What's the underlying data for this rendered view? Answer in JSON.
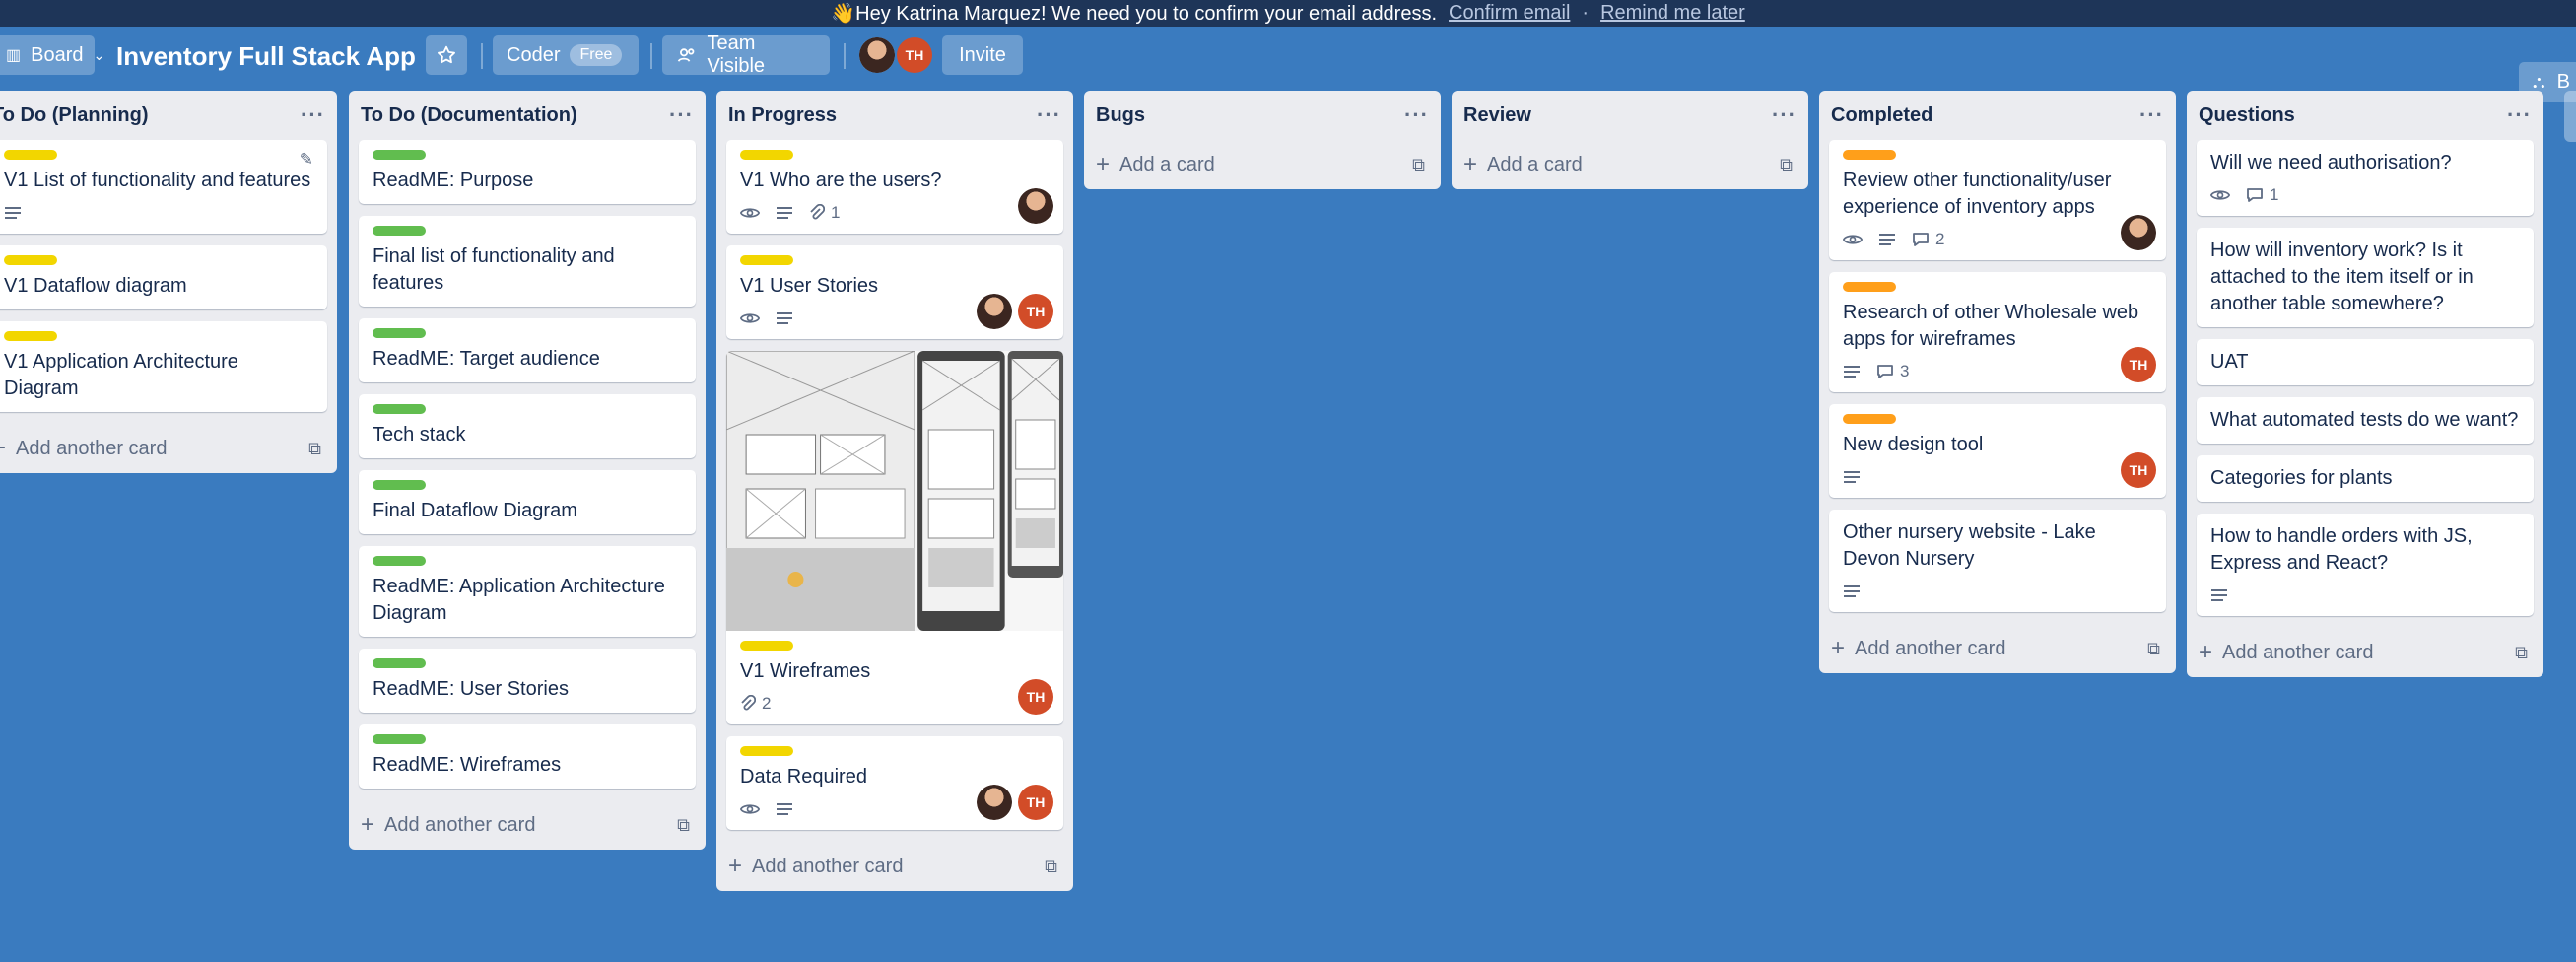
{
  "banner": {
    "message": "👋Hey Katrina Marquez! We need you to confirm your email address.",
    "confirm": "Confirm email",
    "separator": "·",
    "remind": "Remind me later"
  },
  "header": {
    "board_btn": "Board",
    "title": "Inventory Full Stack App",
    "workspace": "Coder",
    "workspace_badge": "Free",
    "visibility": "Team Visible",
    "member_initials": "TH",
    "invite": "Invite",
    "right_btn": "B"
  },
  "lists": [
    {
      "title": "To Do (Planning)",
      "add": "Add another card",
      "cards": [
        {
          "label_color": "#f2d600",
          "text": "V1 List of functionality and features",
          "desc": true,
          "editing": true
        },
        {
          "label_color": "#f2d600",
          "text": "V1 Dataflow diagram"
        },
        {
          "label_color": "#f2d600",
          "text": "V1 Application Architecture Diagram"
        }
      ]
    },
    {
      "title": "To Do (Documentation)",
      "add": "Add another card",
      "cards": [
        {
          "label_color": "#61bd4f",
          "text": "ReadME: Purpose"
        },
        {
          "label_color": "#61bd4f",
          "text": "Final list of functionality and features"
        },
        {
          "label_color": "#61bd4f",
          "text": "ReadME: Target audience"
        },
        {
          "label_color": "#61bd4f",
          "text": "Tech stack"
        },
        {
          "label_color": "#61bd4f",
          "text": "Final Dataflow Diagram"
        },
        {
          "label_color": "#61bd4f",
          "text": "ReadME: Application Architecture Diagram"
        },
        {
          "label_color": "#61bd4f",
          "text": "ReadME: User Stories"
        },
        {
          "label_color": "#61bd4f",
          "text": "ReadME: Wireframes"
        }
      ]
    },
    {
      "title": "In Progress",
      "add": "Add another card",
      "cards": [
        {
          "label_color": "#f2d600",
          "text": "V1 Who are the users?",
          "watch": true,
          "desc": true,
          "attach": "1",
          "members": [
            "photo"
          ]
        },
        {
          "label_color": "#f2d600",
          "text": "V1 User Stories",
          "watch": true,
          "desc": true,
          "members": [
            "photo",
            "TH"
          ]
        },
        {
          "label_color": "#f2d600",
          "text": "V1 Wireframes",
          "cover": true,
          "attach": "2",
          "members": [
            "TH"
          ]
        },
        {
          "label_color": "#f2d600",
          "text": "Data Required",
          "watch": true,
          "desc": true,
          "members": [
            "photo",
            "TH"
          ]
        }
      ]
    },
    {
      "title": "Bugs",
      "add": "Add a card",
      "cards": []
    },
    {
      "title": "Review",
      "add": "Add a card",
      "cards": []
    },
    {
      "title": "Completed",
      "add": "Add another card",
      "cards": [
        {
          "label_color": "#ff9f1a",
          "text": "Review other functionality/user experience of inventory apps",
          "watch": true,
          "desc": true,
          "comments": "2",
          "members": [
            "photo"
          ]
        },
        {
          "label_color": "#ff9f1a",
          "text": "Research of other Wholesale web apps for wireframes",
          "desc": true,
          "comments": "3",
          "members": [
            "TH"
          ]
        },
        {
          "label_color": "#ff9f1a",
          "text": "New design tool",
          "desc": true,
          "members": [
            "TH"
          ]
        },
        {
          "text": "Other nursery website - Lake Devon Nursery",
          "desc": true
        }
      ]
    },
    {
      "title": "Questions",
      "add": "Add another card",
      "cards": [
        {
          "text": "Will we need authorisation?",
          "watch": true,
          "comments": "1"
        },
        {
          "text": "How will inventory work? Is it attached to the item itself or in another table somewhere?"
        },
        {
          "text": "UAT"
        },
        {
          "text": "What automated tests do we want?"
        },
        {
          "text": "Categories for plants"
        },
        {
          "text": "How to handle orders with JS, Express and React?",
          "desc": true
        }
      ]
    }
  ]
}
